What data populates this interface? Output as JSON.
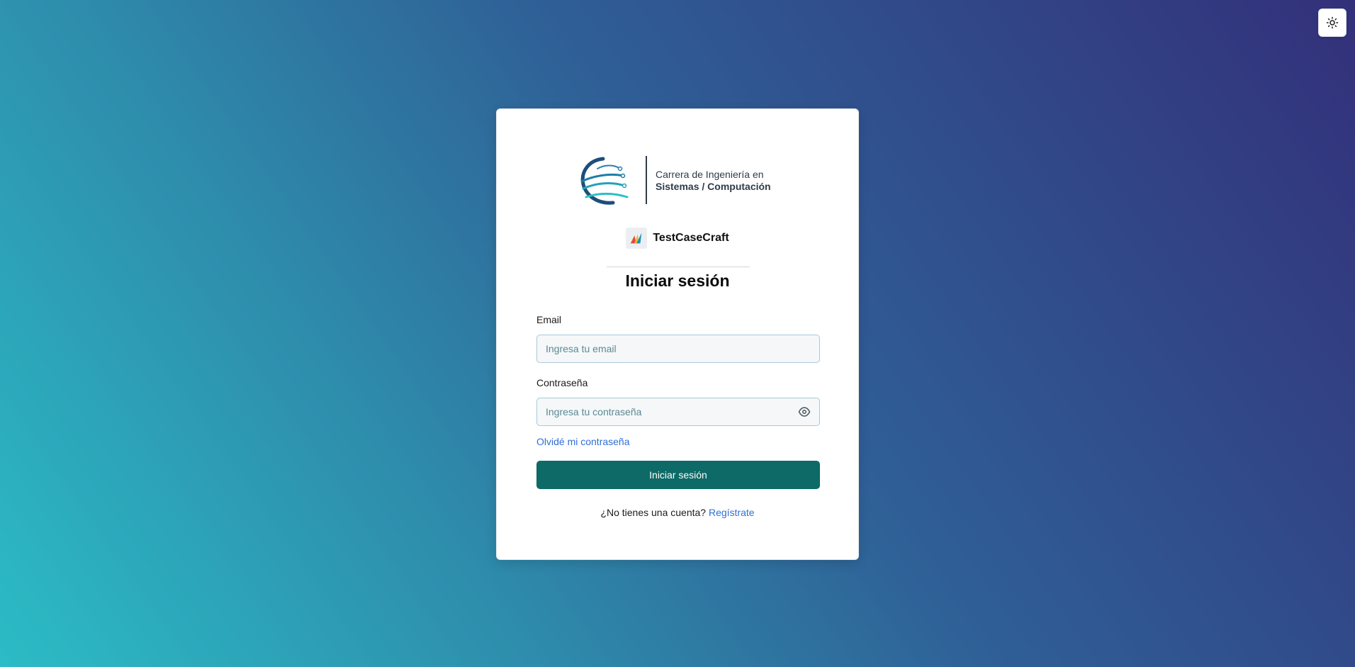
{
  "theme_toggle": {
    "icon": "sun-icon"
  },
  "logo": {
    "line1": "Carrera de Ingeniería en",
    "line2": "Sistemas / Computación"
  },
  "brand": {
    "name": "TestCaseCraft",
    "icon": "testcasecraft-logo-icon"
  },
  "form": {
    "title": "Iniciar sesión",
    "email_label": "Email",
    "email_placeholder": "Ingresa tu email",
    "password_label": "Contraseña",
    "password_placeholder": "Ingresa tu contraseña",
    "forgot_link": "Olvidé mi contraseña",
    "submit_label": "Iniciar sesión",
    "register_prompt": "¿No tienes una cuenta?",
    "register_link": "Regístrate"
  },
  "colors": {
    "primary_button": "#0d6a67",
    "link": "#2f6fd6",
    "background_start": "#2bbcc6",
    "background_end": "#33307a"
  }
}
